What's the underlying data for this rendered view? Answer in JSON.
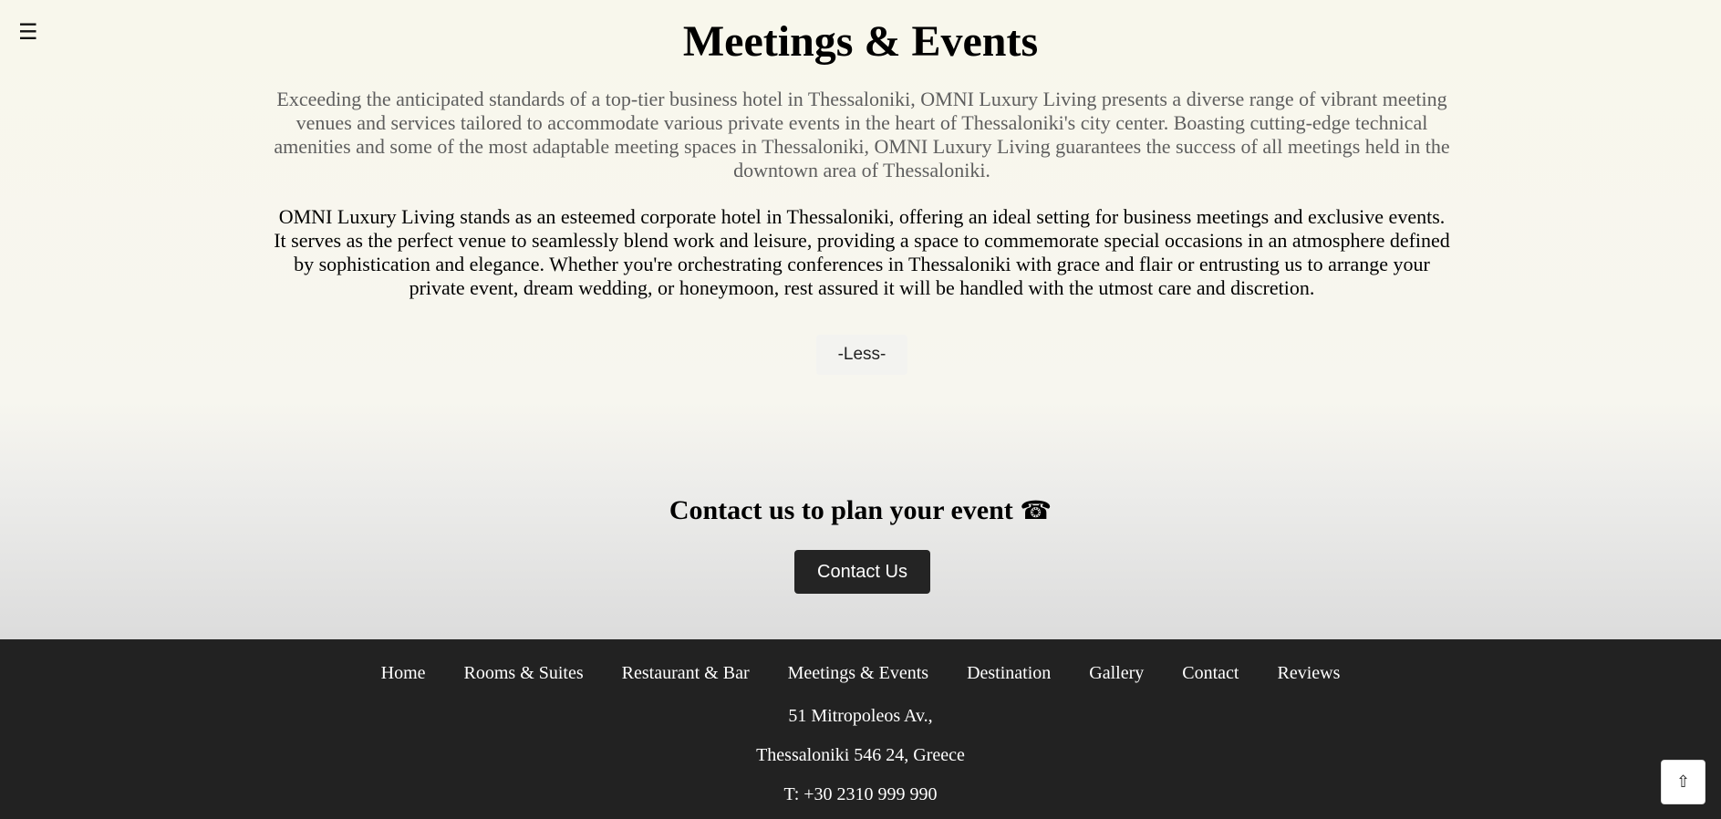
{
  "menu": {
    "icon": "hamburger-menu-icon",
    "glyph": "☰"
  },
  "page": {
    "title": "Meetings & Events",
    "intro": "Exceeding the anticipated standards of a top-tier business hotel in Thessaloniki, OMNI Luxury Living presents a diverse range of vibrant meeting venues and services tailored to accommodate various private events in the heart of Thessaloniki's city center. Boasting cutting-edge technical amenities and some of the most adaptable meeting spaces in Thessaloniki, OMNI Luxury Living guarantees the success of all meetings held in the downtown area of Thessaloniki.",
    "body": "OMNI Luxury Living stands as an esteemed corporate hotel in Thessaloniki, offering an ideal setting for business meetings and exclusive events. It serves as the perfect venue to seamlessly blend work and leisure, providing a space to commemorate special occasions in an atmosphere defined by sophistication and elegance. Whether you're orchestrating conferences in Thessaloniki with grace and flair or entrusting us to arrange your private event, dream wedding, or honeymoon, rest assured it will be handled with the utmost care and discretion.",
    "less_label": "-Less-"
  },
  "contact": {
    "heading": "Contact us to plan your event",
    "phone_icon": "telephone-icon",
    "phone_glyph": "☎",
    "button_label": "Contact Us"
  },
  "footer": {
    "nav": [
      "Home",
      "Rooms & Suites",
      "Restaurant & Bar",
      "Meetings & Events",
      "Destination",
      "Gallery",
      "Contact",
      "Reviews"
    ],
    "address_line1": "51 Mitropoleos Av.,",
    "address_line2": "Thessaloniki 546 24, Greece",
    "phone": "T: +30 2310 999 990"
  },
  "scroll_top": {
    "icon": "arrow-up-icon",
    "glyph": "⇧"
  },
  "colors": {
    "background": "#f8f7ee",
    "footer": "#222222",
    "button": "#242424",
    "intro_text": "#5e5e5e"
  }
}
